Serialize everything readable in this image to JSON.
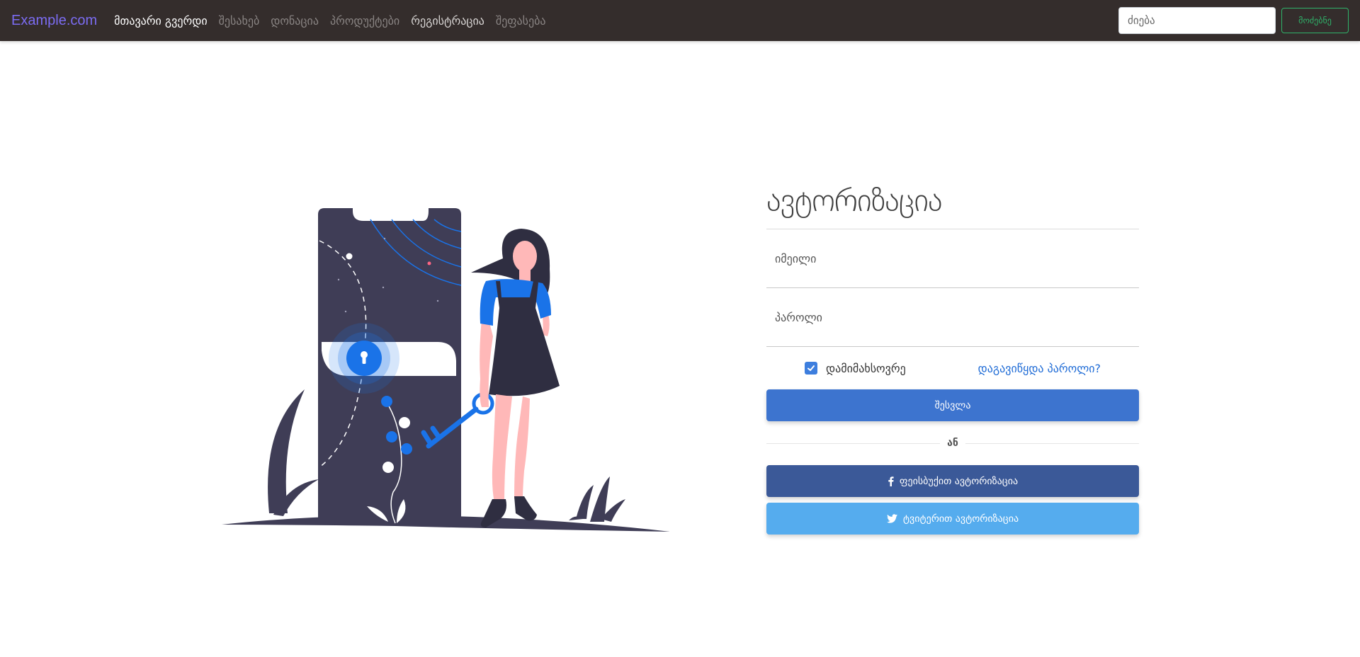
{
  "navbar": {
    "brand": "Example.com",
    "links": [
      {
        "label": "მთავარი გვერდი",
        "state": "active"
      },
      {
        "label": "შესახებ",
        "state": "muted"
      },
      {
        "label": "დონაცია",
        "state": "muted"
      },
      {
        "label": "პროდუქტები",
        "state": "muted"
      },
      {
        "label": "რეგისტრაცია",
        "state": "light"
      },
      {
        "label": "შეფასება",
        "state": "muted"
      }
    ],
    "search_placeholder": "ძიება",
    "search_button": "მოძებნე"
  },
  "login": {
    "title": "ავტორიზაცია",
    "email_placeholder": "იმეილი",
    "password_placeholder": "პაროლი",
    "remember_label": "დამიმახსოვრე",
    "remember_checked": true,
    "forgot_link": "დაგავიწყდა პაროლი?",
    "submit_label": "შესვლა",
    "divider_text": "ან",
    "facebook_label": "ფეისბუქით ავტორიზაცია",
    "twitter_label": "ტვიტერით ავტორიზაცია"
  },
  "colors": {
    "navbar_bg": "#342d2c",
    "brand": "#7b6cf2",
    "primary": "#3d74cf",
    "facebook": "#3b5998",
    "twitter": "#55acee",
    "search_btn": "#2fb36a",
    "illustration_dark": "#3f3d56",
    "illustration_blue": "#1a73e8"
  },
  "icons": {
    "facebook": "facebook-icon",
    "twitter": "twitter-icon",
    "checkbox": "checkmark-icon",
    "keyhole": "keyhole-icon"
  }
}
